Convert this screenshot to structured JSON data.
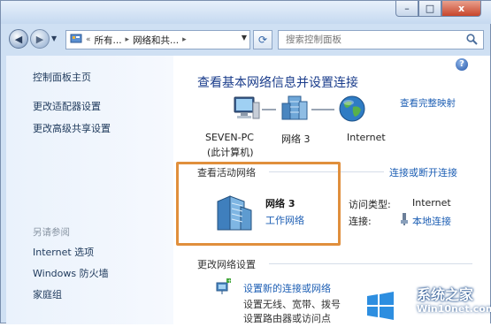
{
  "window": {
    "controls": {
      "minimize": "–",
      "maximize": "□",
      "close": "x"
    }
  },
  "nav": {
    "back_icon": "back-arrow-icon",
    "forward_icon": "forward-arrow-icon",
    "breadcrumb": [
      "«",
      "所有...",
      "网络和共..."
    ],
    "search_placeholder": "搜索控制面板"
  },
  "sidebar": {
    "items": [
      "控制面板主页",
      "更改适配器设置",
      "更改高级共享设置"
    ],
    "see_also_heading": "另请参阅",
    "see_also_items": [
      "Internet 选项",
      "Windows 防火墙",
      "家庭组"
    ]
  },
  "main": {
    "title": "查看基本网络信息并设置连接",
    "map_link": "查看完整映射",
    "nodes": [
      {
        "label": "SEVEN-PC",
        "sublabel": "(此计算机)",
        "icon": "computer-icon"
      },
      {
        "label": "网络  3",
        "icon": "network-icon"
      },
      {
        "label": "Internet",
        "icon": "globe-icon"
      }
    ],
    "active_heading": "查看活动网络",
    "connect_link": "连接或断开连接",
    "active_network": {
      "name": "网络  3",
      "type_link": "工作网络",
      "access_type_label": "访问类型:",
      "access_type_value": "Internet",
      "connection_label": "连接:",
      "connection_value": "本地连接"
    },
    "change_heading": "更改网络设置",
    "change_items": [
      {
        "link": "设置新的连接或网络",
        "desc1": "设置无线、宽带、拨号",
        "desc2": "设置路由器或访问点"
      }
    ]
  },
  "watermark": {
    "line1": "系统之家",
    "line2": "Win10net.com"
  },
  "colors": {
    "link": "#1e5fb4",
    "title": "#1a3c8b",
    "highlight": "#e08f3c"
  }
}
